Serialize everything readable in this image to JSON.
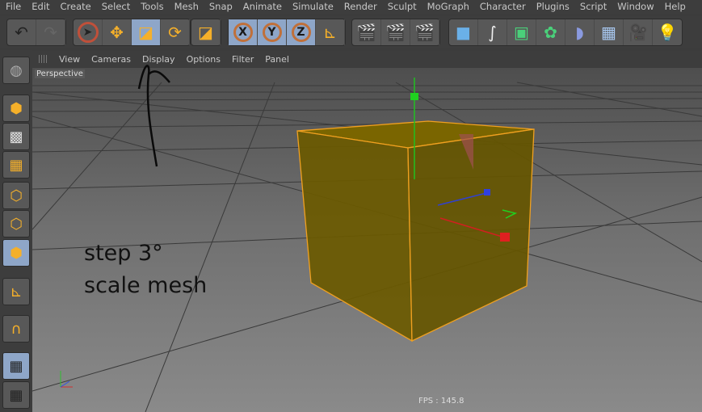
{
  "menu": [
    "File",
    "Edit",
    "Create",
    "Select",
    "Tools",
    "Mesh",
    "Snap",
    "Animate",
    "Simulate",
    "Render",
    "Sculpt",
    "MoGraph",
    "Character",
    "Plugins",
    "Script",
    "Window",
    "Help"
  ],
  "viewport_menu": [
    "View",
    "Cameras",
    "Display",
    "Options",
    "Filter",
    "Panel"
  ],
  "viewport_label": "Perspective",
  "fps": "FPS : 145.8",
  "annotation": {
    "line1": "step 3°",
    "line2": "scale mesh"
  },
  "axes": {
    "x": "X",
    "y": "Y",
    "z": "Z"
  },
  "active_tool": "scale",
  "colors": {
    "accent": "#f5b02a",
    "active": "#8ea6c8",
    "cube_fill": "#6b5a00",
    "cube_edge": "#f0a020"
  }
}
